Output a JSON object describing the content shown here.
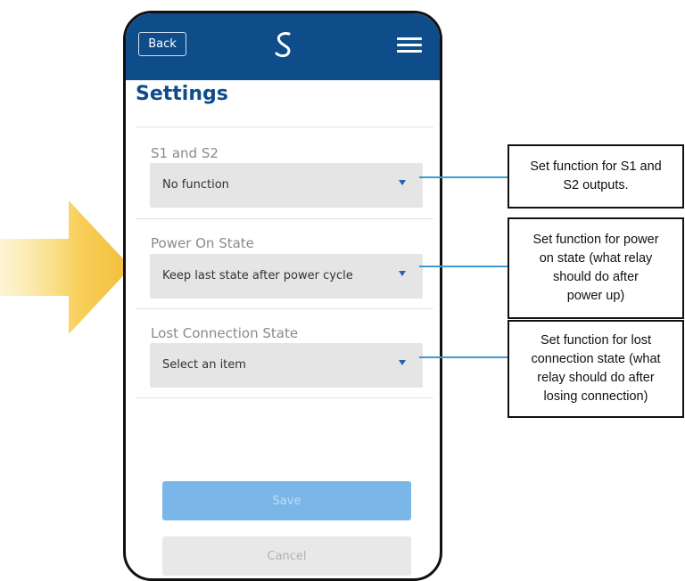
{
  "header": {
    "back_label": "Back"
  },
  "page": {
    "title": "Settings"
  },
  "fields": [
    {
      "label": "S1 and S2",
      "value": "No function"
    },
    {
      "label": "Power On State",
      "value": "Keep last state after power cycle"
    },
    {
      "label": "Lost Connection State",
      "value": "Select an item"
    }
  ],
  "actions": {
    "save_label": "Save",
    "cancel_label": "Cancel"
  },
  "callouts": [
    "Set function for S1 and\nS2 outputs.",
    "Set function for power\non state (what relay\nshould do after\npower up)",
    "Set function for lost\nconnection state (what\nrelay should do after\nlosing connection)"
  ],
  "colors": {
    "header_blue": "#0e4d8a",
    "save_button": "#7bb6e8",
    "leader_line": "#3b9bd1",
    "arrow_yellow": "#f5c242"
  },
  "icons": {
    "logo": "salus-s-logo-icon",
    "menu": "hamburger-menu-icon",
    "dropdown": "caret-down-icon",
    "pointer": "pointing-arrow-icon"
  }
}
